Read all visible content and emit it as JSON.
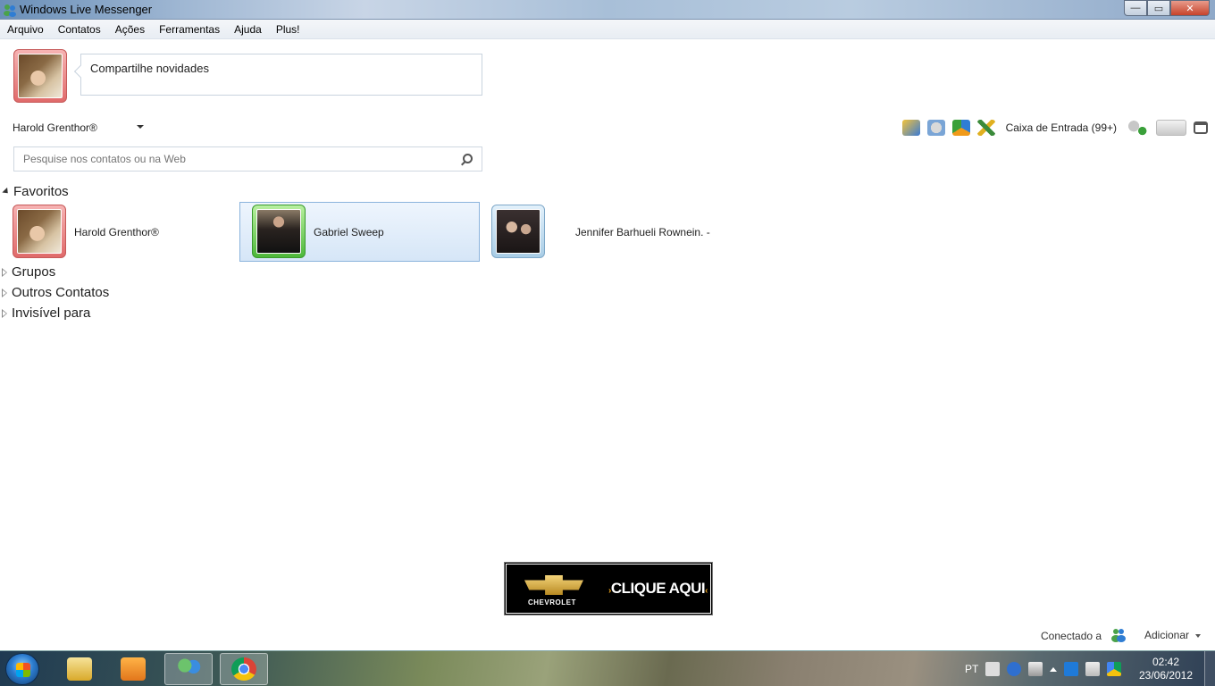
{
  "window": {
    "title": "Windows Live Messenger",
    "minimize": "—",
    "maximize": "▭",
    "close": "✕"
  },
  "menu": [
    "Arquivo",
    "Contatos",
    "Ações",
    "Ferramentas",
    "Ajuda",
    "Plus!"
  ],
  "profile": {
    "status_message": "Compartilhe novidades",
    "name": "Harold Grenthor®"
  },
  "toolbar": {
    "inbox_label": "Caixa de Entrada (99+)"
  },
  "search": {
    "placeholder": "Pesquise nos contatos ou na Web"
  },
  "groups": {
    "favorites": "Favoritos",
    "groups": "Grupos",
    "others": "Outros Contatos",
    "invisible": "Invisível para"
  },
  "favorites": [
    {
      "name": "Harold Grenthor®",
      "status": "busy"
    },
    {
      "name": "Gabriel Sweep",
      "status": "online"
    },
    {
      "name": "Jennifer Barhueli Rownein. -",
      "status": "offline"
    }
  ],
  "ad": {
    "brand": "CHEVROLET",
    "cta": "CLIQUE AQUI"
  },
  "footer": {
    "connected": "Conectado a",
    "add": "Adicionar"
  },
  "taskbar": {
    "language": "PT",
    "time": "02:42",
    "date": "23/06/2012"
  },
  "colors": {
    "busy": "#e06a6a",
    "online": "#4db83a",
    "offline": "#a9cde6",
    "selection": "#d6e6f7"
  }
}
